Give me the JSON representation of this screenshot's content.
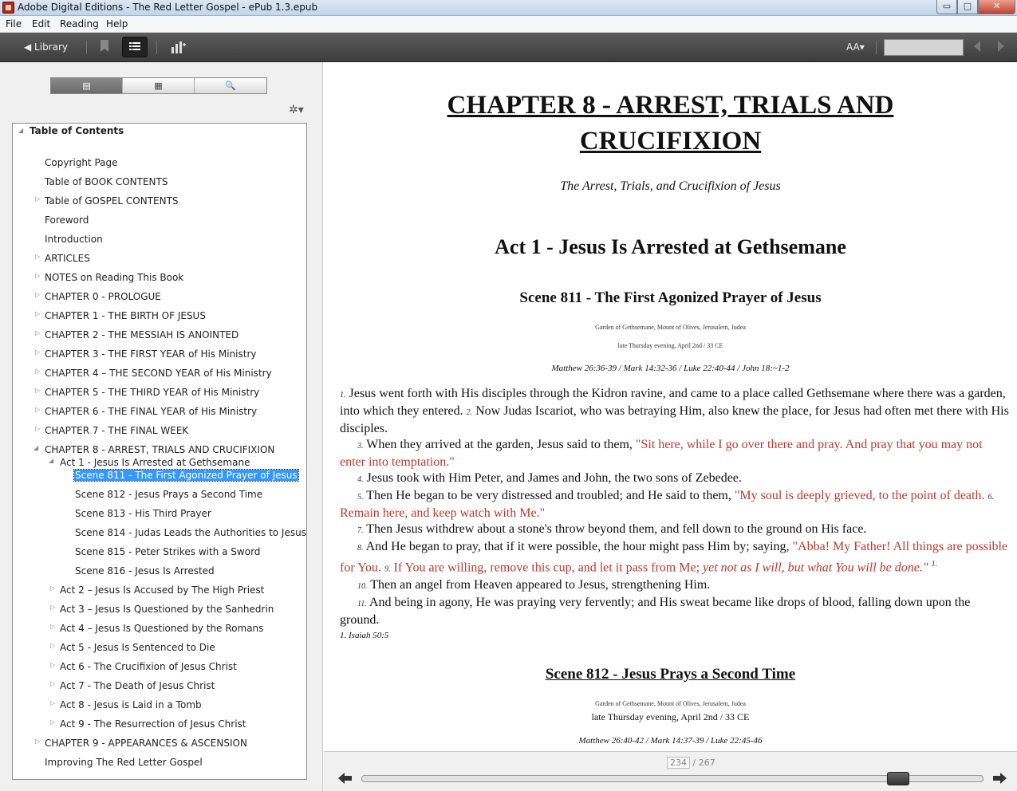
{
  "window": {
    "title": "Adobe Digital Editions - The Red Letter Gospel - ePub 1.3.epub",
    "min": "▭",
    "max": "□",
    "close": "✕"
  },
  "menu": [
    "File",
    "Edit",
    "Reading",
    "Help"
  ],
  "toolbar": {
    "library_label": "◀ Library",
    "font_size_label": "AA▾",
    "icons": [
      "bookmark-icon",
      "list-icon",
      "chart-add-icon",
      "prev-icon",
      "next-icon"
    ]
  },
  "sidebar": {
    "tabs": [
      "▤",
      "▦",
      "🔍"
    ],
    "gear": "✲▾",
    "toc_header": "Table of Contents",
    "items": [
      "Copyright Page",
      "Table of BOOK CONTENTS",
      "Table of GOSPEL CONTENTS",
      "Foreword",
      "Introduction",
      "ARTICLES",
      "NOTES on Reading This Book",
      "CHAPTER 0 - PROLOGUE",
      "CHAPTER 1 - THE BIRTH OF JESUS",
      "CHAPTER 2 - THE MESSIAH IS ANOINTED",
      "CHAPTER 3 - THE FIRST YEAR of His Ministry",
      "CHAPTER 4 – THE SECOND YEAR of His Ministry",
      "CHAPTER 5 - THE THIRD YEAR of His Ministry",
      "CHAPTER 6 - THE FINAL YEAR of His Ministry",
      "CHAPTER 7 - THE FINAL WEEK",
      "CHAPTER 8 - ARREST, TRIALS AND CRUCIFIXION",
      "Act 1 - Jesus Is Arrested at Gethsemane",
      "Scene 811 - The First Agonized Prayer of Jesus",
      "Scene 812 - Jesus Prays a Second Time",
      "Scene 813 - His Third Prayer",
      "Scene 814 - Judas Leads the Authorities to Jesus",
      "Scene 815 - Peter Strikes with a Sword",
      "Scene 816 - Jesus Is Arrested",
      "Act 2 – Jesus Is Accused by The High Priest",
      "Act 3 – Jesus Is Questioned by the Sanhedrin",
      "Act 4 – Jesus Is Questioned by the Romans",
      "Act 5 - Jesus Is Sentenced to Die",
      "Act 6 - The Crucifixion of Jesus Christ",
      "Act 7 - The Death of Jesus Christ",
      "Act 8 - Jesus is Laid in a Tomb",
      "Act 9 - The Resurrection of Jesus Christ",
      "CHAPTER 9 - APPEARANCES & ASCENSION",
      "Improving The Red Letter Gospel"
    ]
  },
  "reader": {
    "chapter_line1": "CHAPTER 8 - ARREST, TRIALS AND",
    "chapter_line2": "CRUCIFIXION",
    "subtitle": "The Arrest, Trials, and Crucifixion of Jesus",
    "act_title": "Act 1 - Jesus Is Arrested at Gethsemane",
    "scene1_title": "Scene 811 - The First Agonized Prayer of Jesus",
    "scene1_location": "Garden of Gethsemane, Mount of Olives, Jerusalem, Judea",
    "scene1_time": "late Thursday evening, April 2nd / 33 CE",
    "scene1_refs": "Matthew 26:36-39 / Mark 14:32-36 / Luke 22:40-44 / John 18:~1-2",
    "verses": {
      "v1n": "1.",
      "v1": "Jesus went forth with His disciples through the Kidron ravine, and came to a place called Gethsemane where there was a garden, into which they entered.",
      "v2n": "2.",
      "v2": "Now Judas Iscariot, who was betraying Him, also knew the place, for Jesus had often met there with His disciples.",
      "v3n": "3.",
      "v3": "When they arrived at the garden, Jesus said to them,",
      "v3r": "\"Sit here, while I go over there and pray.  And pray that you may not enter into temptation.\"",
      "v4n": "4.",
      "v4": "Jesus took with Him Peter, and James and John, the two sons of Zebedee.",
      "v5n": "5.",
      "v5": "Then He began to be very distressed and troubled; and He said to them,",
      "v5r": "\"My soul is deeply grieved, to the point of death.",
      "v6n": "6.",
      "v6r": "Remain here, and keep watch with Me.\"",
      "v7n": "7.",
      "v7": "Then Jesus withdrew about a stone's throw beyond them, and fell down to the ground on His face.",
      "v8n": "8.",
      "v8": "And He began to pray, that if it were possible, the hour might pass Him by; saying,",
      "v8r": "\"Abba!  My Father!  All things are possible for You.",
      "v9n": "9.",
      "v9r": "If You are willing, remove this cup, and let it pass from Me;",
      "v9ri": "yet not as I will, but what You will be done.\"",
      "fnref": "1.",
      "v10n": "10.",
      "v10": "Then an angel from Heaven appeared to Jesus, strengthening Him.",
      "v11n": "11.",
      "v11": "And being in agony, He was praying very fervently; and His sweat became like drops of blood, falling down upon the ground."
    },
    "footnote": "1.  Isaiah 50:5",
    "scene2_title": "Scene 812 - Jesus Prays a Second Time",
    "scene2_location": "Garden of Gethsemane, Mount of Olives, Jerusalem, Judea",
    "scene2_time": "late Thursday evening, April 2nd / 33 CE",
    "scene2_refs": "Matthew 26:40-42  /  Mark 14:37-39  /  Luke 22:45-46"
  },
  "pager": {
    "current": "234",
    "total": "/ 267",
    "progress": 0.876
  }
}
